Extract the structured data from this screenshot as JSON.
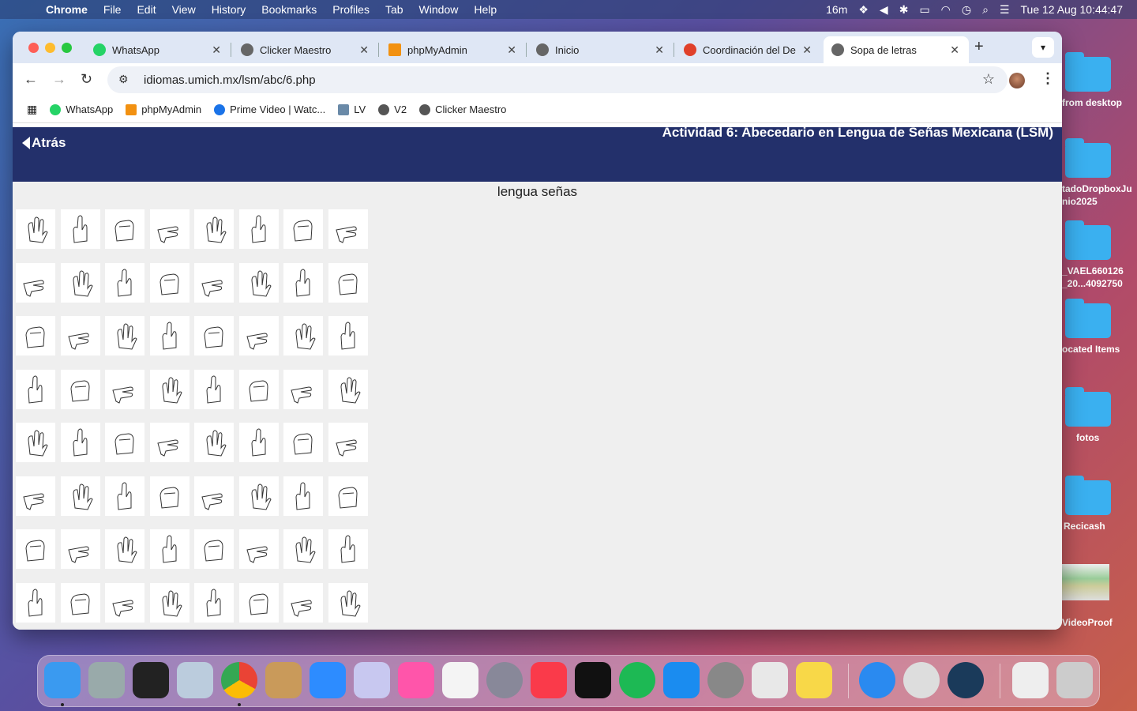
{
  "menubar": {
    "items": [
      "Chrome",
      "File",
      "Edit",
      "View",
      "History",
      "Bookmarks",
      "Profiles",
      "Tab",
      "Window",
      "Help"
    ],
    "status_timer": "16m",
    "clock": "Tue 12 Aug  10:44:47"
  },
  "desktop": {
    "items": [
      {
        "label": "from desktop"
      },
      {
        "label": "tadoDropboxJu\nnio2025"
      },
      {
        "label": "_VAEL660126\n_20...4092750"
      },
      {
        "label": "ocated Items"
      },
      {
        "label": "fotos"
      },
      {
        "label": "Recicash"
      },
      {
        "label": "VideoProof"
      }
    ]
  },
  "browser": {
    "tabs": [
      {
        "label": "WhatsApp",
        "icon": "whatsapp-icon",
        "color": "#25d366"
      },
      {
        "label": "Clicker Maestro",
        "icon": "globe-icon",
        "color": "#555"
      },
      {
        "label": "phpMyAdmin",
        "icon": "phpmyadmin-icon",
        "color": "#f29111"
      },
      {
        "label": "Inicio",
        "icon": "globe-icon",
        "color": "#555"
      },
      {
        "label": "Coordinación del De",
        "icon": "site-icon",
        "color": "#e0402a"
      },
      {
        "label": "Sopa de letras",
        "icon": "globe-icon",
        "color": "#555"
      }
    ],
    "url": "idiomas.umich.mx/lsm/abc/6.php",
    "bookmarks": [
      {
        "label": "WhatsApp",
        "color": "#25d366"
      },
      {
        "label": "phpMyAdmin",
        "color": "#f29111"
      },
      {
        "label": "Prime Video | Watc...",
        "color": "#1a73e8"
      },
      {
        "label": "LV",
        "color": "#6a8aa8"
      },
      {
        "label": "V2",
        "color": "#555"
      },
      {
        "label": "Clicker Maestro",
        "color": "#555"
      }
    ]
  },
  "page": {
    "back_label": "Atrás",
    "title": "Actividad 6: Abecedario en Lengua de Señas Mexicana (LSM)",
    "word_list": "lengua señas",
    "header_color": "#23306b",
    "grid": {
      "rows": 8,
      "cols": 8,
      "icon": "hand-sign-icon"
    }
  },
  "dock": {
    "apps": [
      "Finder",
      "Launchpad",
      "Widgets",
      "Preview",
      "Chrome",
      "Contacts",
      "Zoom",
      "BBEdit",
      "Photos",
      "TextEdit",
      "TeX",
      "Music",
      "TV",
      "Spotify",
      "App Store",
      "System Settings",
      "Grapher",
      "Notes",
      "Safari",
      "LaTeXiT",
      "QuickTime",
      "Documents",
      "Trash"
    ]
  }
}
